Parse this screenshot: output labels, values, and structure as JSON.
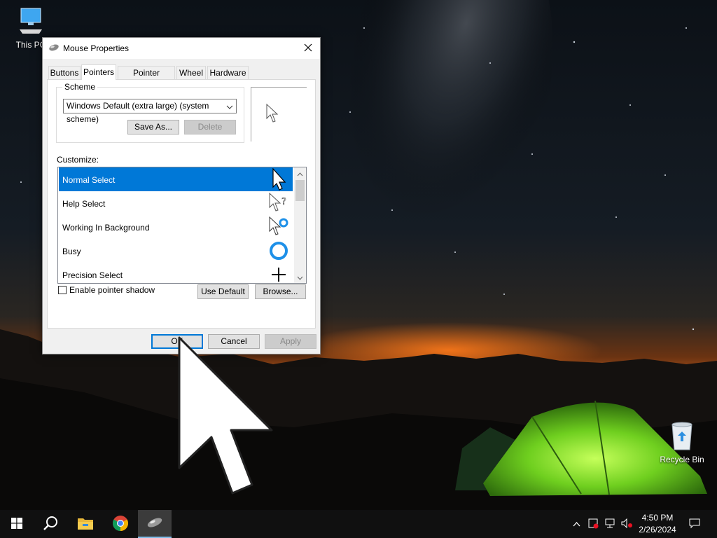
{
  "desktop": {
    "icons": [
      {
        "label": "This PC",
        "icon": "computer-icon"
      },
      {
        "label": "Recycle Bin",
        "icon": "recycle-bin-icon"
      }
    ]
  },
  "dialog": {
    "title": "Mouse Properties",
    "tabs": [
      {
        "label": "Buttons",
        "active": false
      },
      {
        "label": "Pointers",
        "active": true
      },
      {
        "label": "Pointer Options",
        "active": false
      },
      {
        "label": "Wheel",
        "active": false
      },
      {
        "label": "Hardware",
        "active": false
      }
    ],
    "scheme": {
      "label": "Scheme",
      "selected": "Windows Default (extra large) (system scheme)",
      "save_as_label": "Save As...",
      "delete_label": "Delete"
    },
    "customize_label": "Customize:",
    "pointers": [
      {
        "name": "Normal Select",
        "icon": "arrow-cursor-icon",
        "selected": true
      },
      {
        "name": "Help Select",
        "icon": "help-cursor-icon",
        "selected": false
      },
      {
        "name": "Working In Background",
        "icon": "working-cursor-icon",
        "selected": false
      },
      {
        "name": "Busy",
        "icon": "busy-cursor-icon",
        "selected": false
      },
      {
        "name": "Precision Select",
        "icon": "crosshair-cursor-icon",
        "selected": false
      }
    ],
    "enable_shadow_label": "Enable pointer shadow",
    "enable_shadow_checked": false,
    "use_default_label": "Use Default",
    "browse_label": "Browse...",
    "ok_label": "OK",
    "cancel_label": "Cancel",
    "apply_label": "Apply"
  },
  "taskbar": {
    "time": "4:50 PM",
    "date": "2/26/2024",
    "pinned": [
      "start-icon",
      "search-icon",
      "file-explorer-icon",
      "chrome-icon",
      "mouse-icon"
    ]
  },
  "colors": {
    "accent": "#0078d7",
    "taskbar": "#101010",
    "tent_green": "#7cd62a"
  }
}
